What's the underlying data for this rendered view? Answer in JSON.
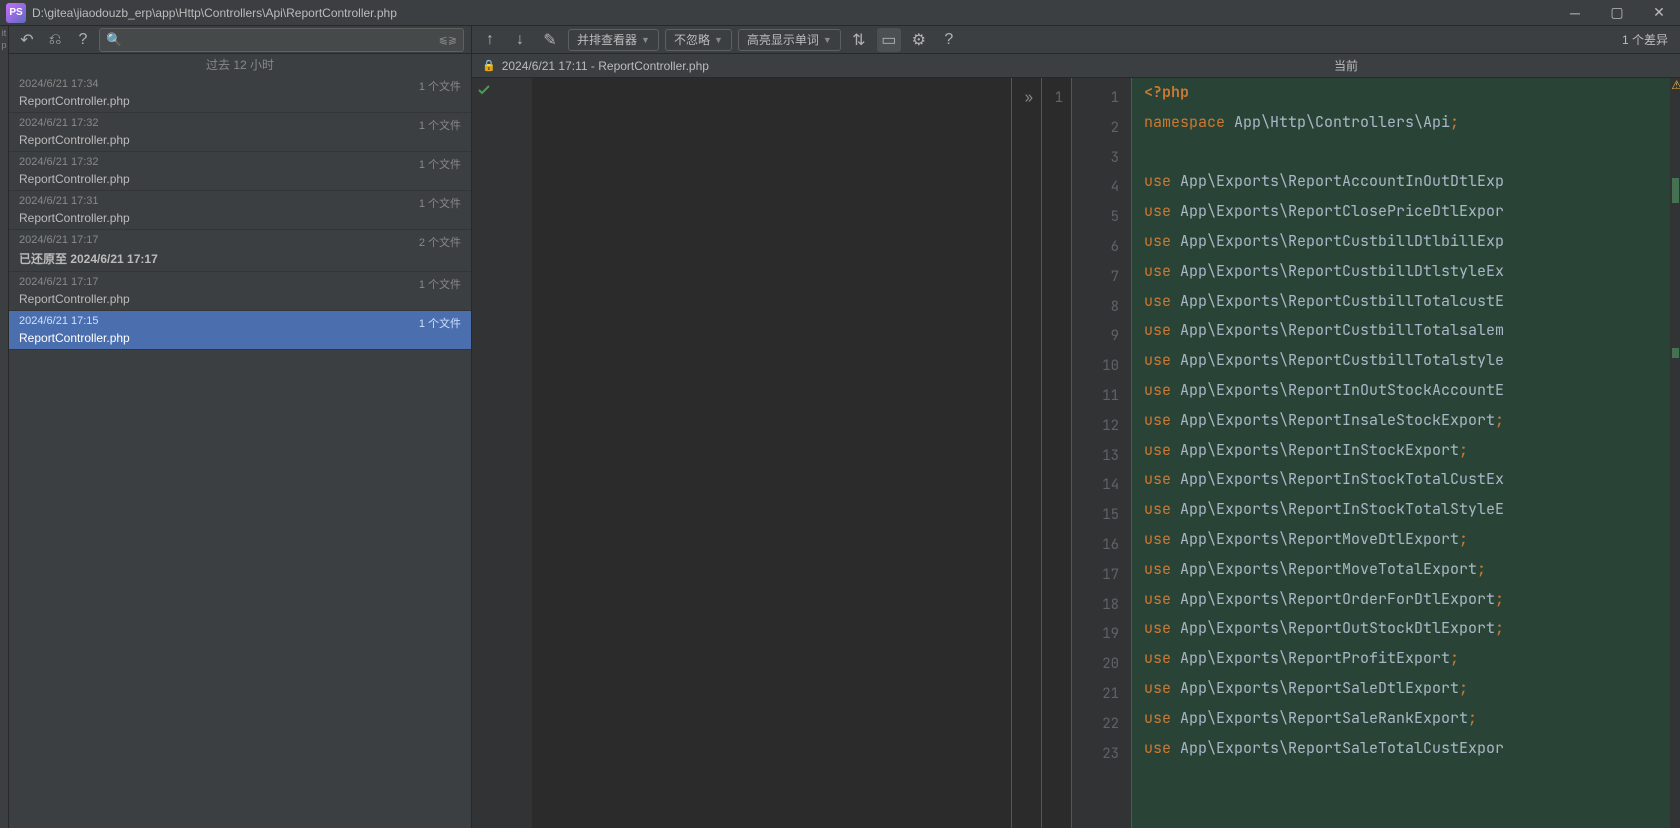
{
  "title_path": "D:\\gitea\\jiaodouzb_erp\\app\\Http\\Controllers\\Api\\ReportController.php",
  "logo_text": "PS",
  "toolbar": {
    "diffview_label": "并排查看器",
    "ignore_label": "不忽略",
    "highlight_label": "高亮显示单词"
  },
  "diff_status": "1 个差异",
  "history_header": "过去 12 小时",
  "file_count_1": "1 个文件",
  "file_count_2": "2 个文件",
  "history": [
    {
      "time": "2024/6/21 17:34",
      "name": "ReportController.php",
      "count": "1 个文件"
    },
    {
      "time": "2024/6/21 17:32",
      "name": "ReportController.php",
      "count": "1 个文件"
    },
    {
      "time": "2024/6/21 17:32",
      "name": "ReportController.php",
      "count": "1 个文件"
    },
    {
      "time": "2024/6/21 17:31",
      "name": "ReportController.php",
      "count": "1 个文件"
    },
    {
      "time": "2024/6/21 17:17",
      "name": "已还原至 2024/6/21 17:17",
      "count": "2 个文件",
      "bold": true
    },
    {
      "time": "2024/6/21 17:17",
      "name": "ReportController.php",
      "count": "1 个文件"
    },
    {
      "time": "2024/6/21 17:15",
      "name": "ReportController.php",
      "count": "1 个文件",
      "selected": true
    }
  ],
  "left_tab": "2024/6/21 17:11 - ReportController.php",
  "right_tab": "当前",
  "left_line": "1",
  "right_lines": [
    "1",
    "2",
    "3",
    "4",
    "5",
    "6",
    "7",
    "8",
    "9",
    "10",
    "11",
    "12",
    "13",
    "14",
    "15",
    "16",
    "17",
    "18",
    "19",
    "20",
    "21",
    "22",
    "23"
  ],
  "code": [
    {
      "type": "phptag",
      "text": "<?php"
    },
    {
      "type": "ns",
      "kw": "namespace",
      "rest": " App\\Http\\Controllers\\Api",
      "semi": ";"
    },
    {
      "type": "blank"
    },
    {
      "type": "use",
      "kw": "use",
      "rest": " App\\Exports\\ReportAccountInOutDtlExp"
    },
    {
      "type": "use",
      "kw": "use",
      "rest": " App\\Exports\\ReportClosePriceDtlExpor"
    },
    {
      "type": "use",
      "kw": "use",
      "rest": " App\\Exports\\ReportCustbillDtlbillExp"
    },
    {
      "type": "use",
      "kw": "use",
      "rest": " App\\Exports\\ReportCustbillDtlstyleEx"
    },
    {
      "type": "use",
      "kw": "use",
      "rest": " App\\Exports\\ReportCustbillTotalcustE"
    },
    {
      "type": "use",
      "kw": "use",
      "rest": " App\\Exports\\ReportCustbillTotalsalem"
    },
    {
      "type": "use",
      "kw": "use",
      "rest": " App\\Exports\\ReportCustbillTotalstyle"
    },
    {
      "type": "use",
      "kw": "use",
      "rest": " App\\Exports\\ReportInOutStockAccountE"
    },
    {
      "type": "use",
      "kw": "use",
      "rest": " App\\Exports\\ReportInsaleStockExport",
      "semi": ";"
    },
    {
      "type": "use",
      "kw": "use",
      "rest": " App\\Exports\\ReportInStockExport",
      "semi": ";"
    },
    {
      "type": "use",
      "kw": "use",
      "rest": " App\\Exports\\ReportInStockTotalCustEx"
    },
    {
      "type": "use",
      "kw": "use",
      "rest": " App\\Exports\\ReportInStockTotalStyleE"
    },
    {
      "type": "use",
      "kw": "use",
      "rest": " App\\Exports\\ReportMoveDtlExport",
      "semi": ";"
    },
    {
      "type": "use",
      "kw": "use",
      "rest": " App\\Exports\\ReportMoveTotalExport",
      "semi": ";"
    },
    {
      "type": "use",
      "kw": "use",
      "rest": " App\\Exports\\ReportOrderForDtlExport",
      "semi": ";"
    },
    {
      "type": "use",
      "kw": "use",
      "rest": " App\\Exports\\ReportOutStockDtlExport",
      "semi": ";"
    },
    {
      "type": "use",
      "kw": "use",
      "rest": " App\\Exports\\ReportProfitExport",
      "semi": ";"
    },
    {
      "type": "use",
      "kw": "use",
      "rest": " App\\Exports\\ReportSaleDtlExport",
      "semi": ";"
    },
    {
      "type": "use",
      "kw": "use",
      "rest": " App\\Exports\\ReportSaleRankExport",
      "semi": ";"
    },
    {
      "type": "use",
      "kw": "use",
      "rest": " App\\Exports\\ReportSaleTotalCustExpor"
    }
  ]
}
